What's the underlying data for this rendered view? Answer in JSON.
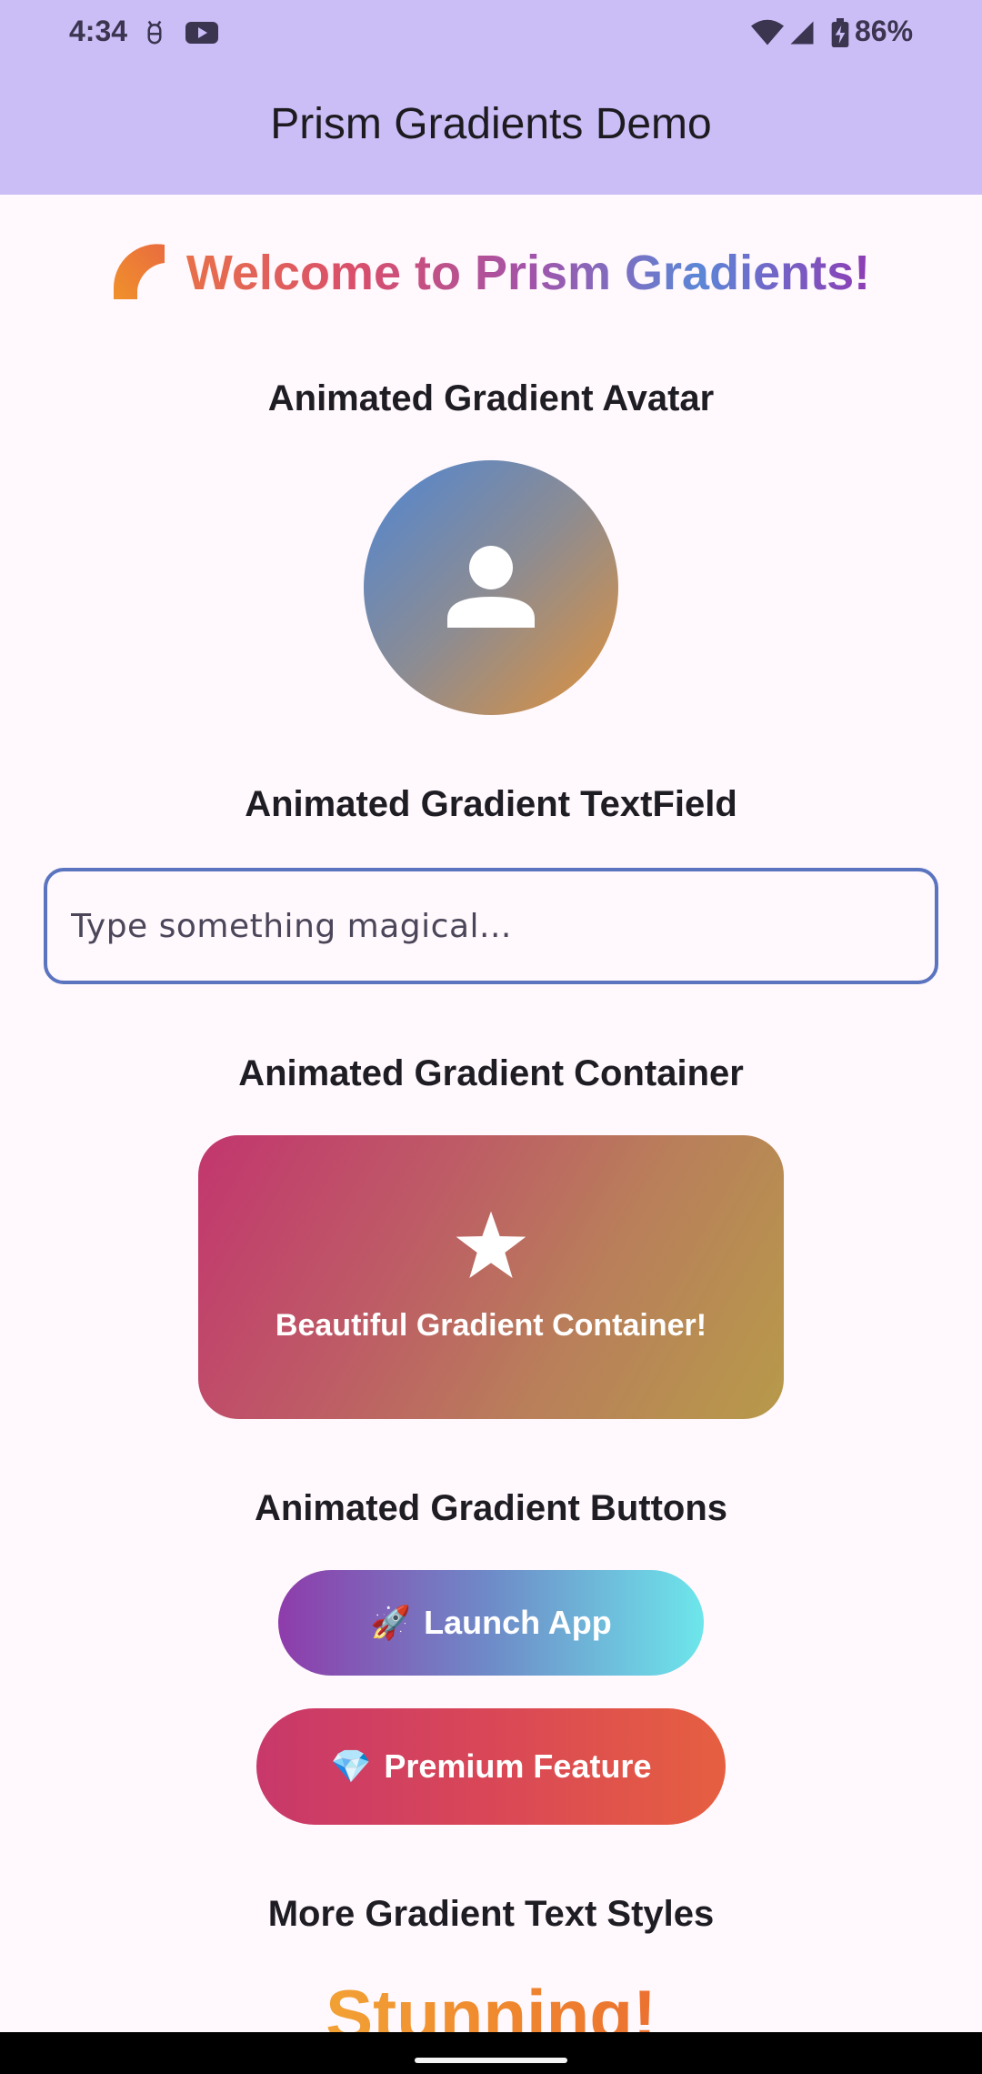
{
  "status_bar": {
    "time": "4:34",
    "battery_percent": "86%",
    "icons": [
      "android-debug-icon",
      "youtube-icon",
      "wifi-icon",
      "cell-signal-icon",
      "battery-charging-icon"
    ]
  },
  "app_bar": {
    "title": "Prism Gradients Demo"
  },
  "welcome": {
    "text": "Welcome to Prism Gradients!",
    "icon": "quarter-circle-icon"
  },
  "sections": {
    "avatar_title": "Animated Gradient Avatar",
    "textfield_title": "Animated Gradient TextField",
    "container_title": "Animated Gradient Container",
    "buttons_title": "Animated Gradient Buttons",
    "text_styles_title": "More Gradient Text Styles"
  },
  "textfield": {
    "placeholder": "Type something magical...",
    "value": ""
  },
  "container": {
    "label": "Beautiful Gradient Container!",
    "icon": "star-icon"
  },
  "buttons": {
    "launch_emoji": "🚀",
    "launch_label": "Launch App",
    "premium_emoji": "💎",
    "premium_label": "Premium Feature"
  },
  "text_styles": {
    "first_sample": "Stunning!"
  },
  "colors": {
    "app_bar": "#CBBEF7",
    "background": "#FFF8FC",
    "textfield_border": "#5A74C0"
  }
}
